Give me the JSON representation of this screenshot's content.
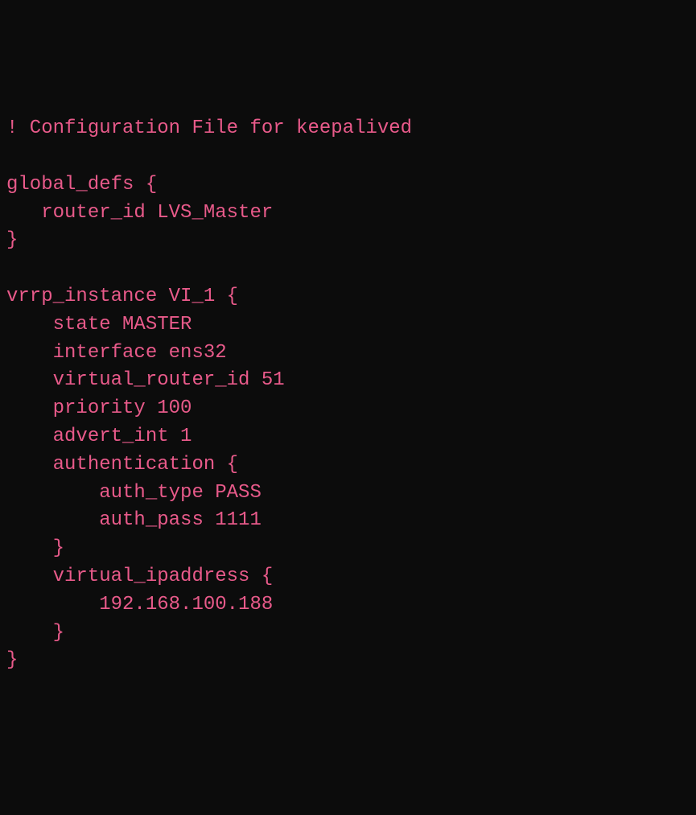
{
  "config": {
    "lines": [
      "! Configuration File for keepalived",
      "",
      "global_defs {",
      "   router_id LVS_Master",
      "}",
      "",
      "vrrp_instance VI_1 {",
      "    state MASTER",
      "    interface ens32",
      "    virtual_router_id 51",
      "    priority 100",
      "    advert_int 1",
      "    authentication {",
      "        auth_type PASS",
      "        auth_pass 1111",
      "    }",
      "    virtual_ipaddress {",
      "        192.168.100.188",
      "    }",
      "}"
    ]
  }
}
